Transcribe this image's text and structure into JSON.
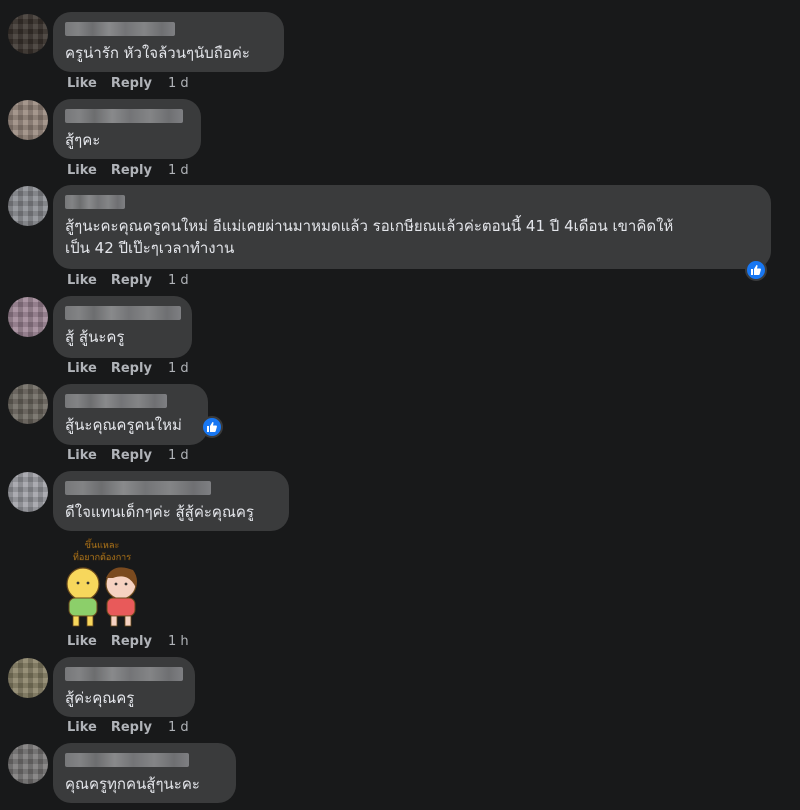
{
  "actions": {
    "like": "Like",
    "reply": "Reply"
  },
  "comments": [
    {
      "text": "ครูน่ารัก หัวใจล้วนๆนับถือค่ะ",
      "time": "1 d"
    },
    {
      "text": "สู้ๆคะ",
      "time": "1 d"
    },
    {
      "text": "สู้ๆนะคะคุณครูคนใหม่ อีแม่เคยผ่านมาหมดแล้ว รอเกษียณแล้วค่ะตอนนี้ 41 ปี 4เดือน เขาคิดให้\nเป็น 42 ปีเป๊ะๆเวลาทำงาน",
      "time": "1 d"
    },
    {
      "text": "สู้ สู้นะครู",
      "time": "1 d"
    },
    {
      "text": "สู้นะคุณครูคนใหม่",
      "time": "1 d"
    },
    {
      "text": "ดีใจแทนเด็กๆค่ะ สู้สู้ค่ะคุณครู",
      "time": "1 h"
    },
    {
      "text": "สู้ค่ะคุณครู",
      "time": "1 d"
    },
    {
      "text": "คุณครูทุกคนสู้ๆนะคะ",
      "time": ""
    }
  ],
  "sticker": {
    "caption": "ขึ้นแหละ ที่อยากต้องการ"
  }
}
